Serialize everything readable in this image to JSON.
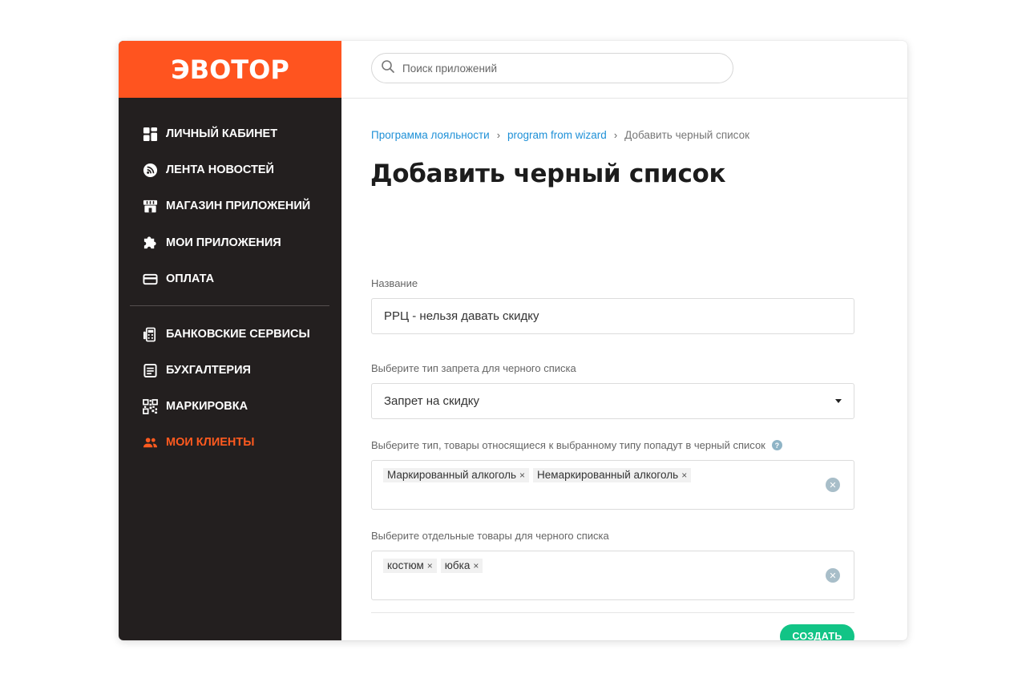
{
  "brand": {
    "logo_text": "ЭВОТОР",
    "accent_color": "#ff541f"
  },
  "sidebar": {
    "primary_items": [
      {
        "label": "ЛИЧНЫЙ КАБИНЕТ",
        "icon": "dashboard-icon"
      },
      {
        "label": "ЛЕНТА НОВОСТЕЙ",
        "icon": "feed-icon"
      },
      {
        "label": "МАГАЗИН ПРИЛОЖЕНИЙ",
        "icon": "store-icon"
      },
      {
        "label": "МОИ ПРИЛОЖЕНИЯ",
        "icon": "puzzle-icon"
      },
      {
        "label": "ОПЛАТА",
        "icon": "credit-card-icon"
      }
    ],
    "secondary_items": [
      {
        "label": "БАНКОВСКИЕ СЕРВИСЫ",
        "icon": "bank-terminal-icon"
      },
      {
        "label": "БУХГАЛТЕРИЯ",
        "icon": "document-icon"
      },
      {
        "label": "МАРКИРОВКА",
        "icon": "qr-code-icon"
      },
      {
        "label": "МОИ КЛИЕНТЫ",
        "icon": "people-icon",
        "active": true
      }
    ]
  },
  "search": {
    "placeholder": "Поиск приложений",
    "value": ""
  },
  "breadcrumb": {
    "items": [
      "Программа лояльности",
      "program from wizard"
    ],
    "current": "Добавить черный список",
    "separator": "›"
  },
  "page": {
    "title": "Добавить черный список"
  },
  "form": {
    "name": {
      "label": "Название",
      "value": "РРЦ - нельзя давать скидку"
    },
    "ban_type": {
      "label": "Выберите тип запрета для черного списка",
      "selected": "Запрет на скидку"
    },
    "product_types": {
      "label": "Выберите тип, товары относящиеся к выбранному типу попадут в черный список",
      "help": "?",
      "tags": [
        "Маркированный алкоголь",
        "Немаркированный алкоголь"
      ]
    },
    "products": {
      "label": "Выберите отдельные товары для черного списка",
      "tags": [
        "костюм",
        "юбка"
      ]
    },
    "tag_remove_glyph": "×",
    "clear_glyph": "✕",
    "submit_label": "СОЗДАТЬ",
    "submit_color": "#12c486"
  }
}
